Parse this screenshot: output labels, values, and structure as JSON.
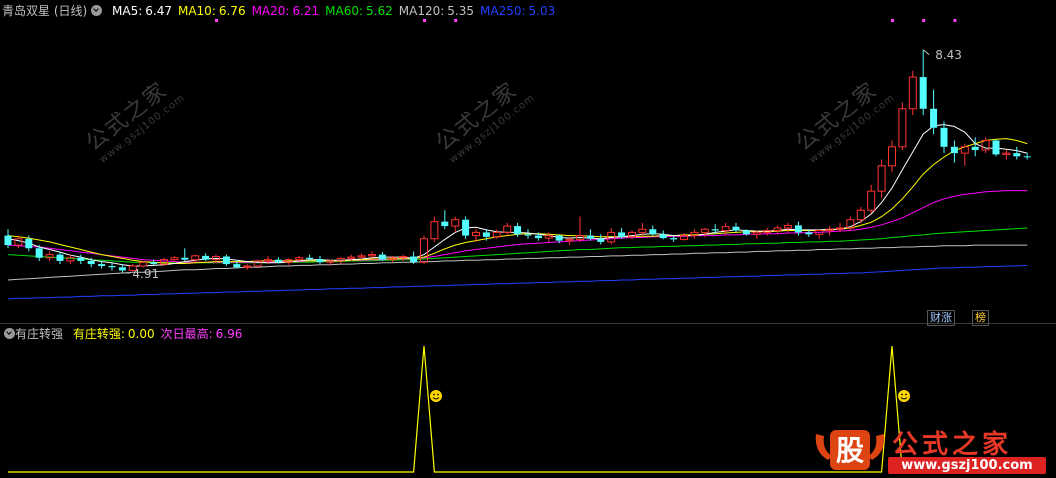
{
  "main_header": {
    "title": "青岛双星 (日线)",
    "ma": [
      {
        "label": "MA5:",
        "value": "6.47",
        "color": "#ffffff"
      },
      {
        "label": "MA10:",
        "value": "6.76",
        "color": "#ffff00"
      },
      {
        "label": "MA20:",
        "value": "6.21",
        "color": "#ff00ff"
      },
      {
        "label": "MA60:",
        "value": "5.62",
        "color": "#00e000"
      },
      {
        "label": "MA120:",
        "value": "5.35",
        "color": "#c0c0c0"
      },
      {
        "label": "MA250:",
        "value": "5.03",
        "color": "#2040ff"
      }
    ]
  },
  "sub_header": {
    "title": "有庄转强",
    "items": [
      {
        "label": "有庄转强:",
        "value": "0.00",
        "color": "#ffff00"
      },
      {
        "label": "次日最高:",
        "value": "6.96",
        "color": "#ff40ff"
      }
    ]
  },
  "annotations": {
    "high_label": "8.43",
    "low_label": "4.91",
    "tag1": "财涨",
    "tag2": "榜"
  },
  "watermark": {
    "text": "公式之家",
    "url": "www.gszj100.com"
  },
  "logo": {
    "mark": "股",
    "name": "公式之家",
    "url": "www.gszj100.com"
  },
  "colors": {
    "up": "#ff3232",
    "down": "#54ffff",
    "bg": "#000000"
  },
  "chart_data": [
    {
      "type": "candlestick",
      "title": "青岛双星 (日线)",
      "ylim": [
        4.2,
        8.9
      ],
      "candles": [
        [
          5.5,
          5.6,
          5.3,
          5.35
        ],
        [
          5.35,
          5.5,
          5.3,
          5.45
        ],
        [
          5.45,
          5.5,
          5.25,
          5.3
        ],
        [
          5.3,
          5.35,
          5.1,
          5.15
        ],
        [
          5.15,
          5.25,
          5.1,
          5.2
        ],
        [
          5.2,
          5.25,
          5.05,
          5.1
        ],
        [
          5.1,
          5.2,
          5.05,
          5.15
        ],
        [
          5.15,
          5.2,
          5.05,
          5.1
        ],
        [
          5.1,
          5.15,
          5.0,
          5.05
        ],
        [
          5.05,
          5.1,
          4.98,
          5.02
        ],
        [
          5.02,
          5.08,
          4.95,
          5.0
        ],
        [
          5.0,
          5.05,
          4.91,
          4.95
        ],
        [
          4.95,
          5.05,
          4.93,
          5.02
        ],
        [
          5.02,
          5.1,
          5.0,
          5.08
        ],
        [
          5.08,
          5.12,
          5.03,
          5.05
        ],
        [
          5.05,
          5.15,
          5.02,
          5.12
        ],
        [
          5.12,
          5.18,
          5.08,
          5.15
        ],
        [
          5.15,
          5.3,
          5.1,
          5.12
        ],
        [
          5.12,
          5.2,
          5.08,
          5.18
        ],
        [
          5.18,
          5.22,
          5.1,
          5.12
        ],
        [
          5.12,
          5.2,
          5.08,
          5.17
        ],
        [
          5.17,
          5.2,
          5.02,
          5.05
        ],
        [
          5.05,
          5.1,
          4.98,
          5.0
        ],
        [
          5.0,
          5.05,
          4.96,
          5.02
        ],
        [
          5.02,
          5.12,
          5.0,
          5.1
        ],
        [
          5.1,
          5.18,
          5.05,
          5.12
        ],
        [
          5.12,
          5.16,
          5.06,
          5.08
        ],
        [
          5.08,
          5.14,
          5.04,
          5.12
        ],
        [
          5.12,
          5.18,
          5.1,
          5.15
        ],
        [
          5.15,
          5.2,
          5.1,
          5.13
        ],
        [
          5.13,
          5.18,
          5.05,
          5.08
        ],
        [
          5.08,
          5.12,
          5.03,
          5.1
        ],
        [
          5.1,
          5.16,
          5.06,
          5.14
        ],
        [
          5.14,
          5.2,
          5.1,
          5.16
        ],
        [
          5.16,
          5.22,
          5.12,
          5.18
        ],
        [
          5.18,
          5.25,
          5.14,
          5.2
        ],
        [
          5.2,
          5.24,
          5.1,
          5.12
        ],
        [
          5.12,
          5.18,
          5.08,
          5.15
        ],
        [
          5.15,
          5.2,
          5.1,
          5.17
        ],
        [
          5.17,
          5.25,
          5.05,
          5.08
        ],
        [
          5.08,
          5.5,
          5.05,
          5.45
        ],
        [
          5.45,
          5.8,
          5.4,
          5.72
        ],
        [
          5.72,
          5.9,
          5.6,
          5.65
        ],
        [
          5.65,
          5.8,
          5.55,
          5.75
        ],
        [
          5.75,
          5.8,
          5.45,
          5.5
        ],
        [
          5.5,
          5.6,
          5.4,
          5.55
        ],
        [
          5.55,
          5.6,
          5.42,
          5.48
        ],
        [
          5.48,
          5.6,
          5.45,
          5.55
        ],
        [
          5.55,
          5.7,
          5.5,
          5.65
        ],
        [
          5.65,
          5.7,
          5.48,
          5.52
        ],
        [
          5.52,
          5.6,
          5.45,
          5.5
        ],
        [
          5.5,
          5.55,
          5.42,
          5.46
        ],
        [
          5.46,
          5.55,
          5.4,
          5.5
        ],
        [
          5.5,
          5.52,
          5.38,
          5.42
        ],
        [
          5.42,
          5.48,
          5.35,
          5.44
        ],
        [
          5.44,
          5.8,
          5.4,
          5.5
        ],
        [
          5.5,
          5.6,
          5.42,
          5.45
        ],
        [
          5.45,
          5.52,
          5.36,
          5.4
        ],
        [
          5.4,
          5.62,
          5.36,
          5.55
        ],
        [
          5.55,
          5.62,
          5.45,
          5.48
        ],
        [
          5.48,
          5.58,
          5.44,
          5.55
        ],
        [
          5.55,
          5.7,
          5.5,
          5.6
        ],
        [
          5.6,
          5.66,
          5.5,
          5.52
        ],
        [
          5.52,
          5.58,
          5.44,
          5.46
        ],
        [
          5.46,
          5.5,
          5.4,
          5.44
        ],
        [
          5.44,
          5.54,
          5.42,
          5.5
        ],
        [
          5.5,
          5.6,
          5.45,
          5.55
        ],
        [
          5.55,
          5.62,
          5.48,
          5.6
        ],
        [
          5.6,
          5.68,
          5.52,
          5.58
        ],
        [
          5.58,
          5.7,
          5.52,
          5.64
        ],
        [
          5.64,
          5.7,
          5.55,
          5.58
        ],
        [
          5.58,
          5.6,
          5.5,
          5.52
        ],
        [
          5.52,
          5.58,
          5.45,
          5.55
        ],
        [
          5.55,
          5.62,
          5.5,
          5.58
        ],
        [
          5.58,
          5.66,
          5.52,
          5.62
        ],
        [
          5.62,
          5.7,
          5.55,
          5.66
        ],
        [
          5.66,
          5.72,
          5.5,
          5.55
        ],
        [
          5.55,
          5.6,
          5.48,
          5.52
        ],
        [
          5.52,
          5.6,
          5.45,
          5.58
        ],
        [
          5.58,
          5.65,
          5.5,
          5.6
        ],
        [
          5.6,
          5.7,
          5.55,
          5.62
        ],
        [
          5.62,
          5.8,
          5.58,
          5.75
        ],
        [
          5.75,
          5.95,
          5.7,
          5.9
        ],
        [
          5.9,
          6.3,
          5.85,
          6.2
        ],
        [
          6.2,
          6.7,
          6.1,
          6.6
        ],
        [
          6.6,
          7.0,
          6.5,
          6.9
        ],
        [
          6.9,
          7.6,
          6.85,
          7.5
        ],
        [
          7.5,
          8.1,
          7.4,
          8.0
        ],
        [
          8.0,
          8.43,
          7.4,
          7.5
        ],
        [
          7.5,
          7.8,
          7.1,
          7.2
        ],
        [
          7.2,
          7.3,
          6.8,
          6.9
        ],
        [
          6.9,
          7.0,
          6.65,
          6.8
        ],
        [
          6.8,
          6.95,
          6.6,
          6.9
        ],
        [
          6.9,
          7.05,
          6.75,
          6.85
        ],
        [
          6.85,
          7.05,
          6.8,
          7.0
        ],
        [
          7.0,
          7.02,
          6.75,
          6.78
        ],
        [
          6.78,
          6.85,
          6.7,
          6.8
        ],
        [
          6.8,
          6.9,
          6.7,
          6.75
        ],
        [
          6.75,
          6.8,
          6.7,
          6.74
        ]
      ],
      "ma5": [
        5.45,
        5.42,
        5.38,
        5.32,
        5.28,
        5.24,
        5.19,
        5.16,
        5.12,
        5.09,
        5.07,
        5.04,
        5.02,
        5.02,
        5.03,
        5.04,
        5.06,
        5.09,
        5.11,
        5.13,
        5.14,
        5.13,
        5.11,
        5.09,
        5.08,
        5.07,
        5.07,
        5.08,
        5.1,
        5.12,
        5.12,
        5.11,
        5.11,
        5.12,
        5.13,
        5.15,
        5.16,
        5.16,
        5.16,
        5.14,
        5.2,
        5.32,
        5.44,
        5.55,
        5.62,
        5.63,
        5.59,
        5.56,
        5.55,
        5.55,
        5.54,
        5.52,
        5.5,
        5.47,
        5.46,
        5.47,
        5.46,
        5.45,
        5.47,
        5.48,
        5.5,
        5.52,
        5.53,
        5.52,
        5.5,
        5.5,
        5.5,
        5.52,
        5.55,
        5.57,
        5.59,
        5.58,
        5.57,
        5.57,
        5.58,
        5.6,
        5.59,
        5.59,
        5.59,
        5.6,
        5.6,
        5.64,
        5.72,
        5.84,
        6.02,
        6.25,
        6.54,
        6.82,
        7.1,
        7.23,
        7.25,
        7.22,
        7.13,
        6.95,
        6.88,
        6.88,
        6.86,
        6.84,
        6.8
      ],
      "ma10": [
        5.5,
        5.48,
        5.46,
        5.43,
        5.4,
        5.36,
        5.32,
        5.28,
        5.24,
        5.2,
        5.17,
        5.14,
        5.11,
        5.09,
        5.08,
        5.07,
        5.06,
        5.06,
        5.07,
        5.08,
        5.09,
        5.09,
        5.09,
        5.09,
        5.1,
        5.1,
        5.1,
        5.1,
        5.1,
        5.1,
        5.1,
        5.1,
        5.1,
        5.11,
        5.12,
        5.13,
        5.13,
        5.13,
        5.14,
        5.14,
        5.16,
        5.22,
        5.29,
        5.35,
        5.39,
        5.42,
        5.45,
        5.48,
        5.5,
        5.52,
        5.53,
        5.53,
        5.52,
        5.51,
        5.5,
        5.5,
        5.49,
        5.48,
        5.48,
        5.48,
        5.48,
        5.49,
        5.49,
        5.5,
        5.5,
        5.51,
        5.51,
        5.52,
        5.53,
        5.54,
        5.55,
        5.56,
        5.56,
        5.56,
        5.57,
        5.58,
        5.58,
        5.58,
        5.58,
        5.59,
        5.6,
        5.62,
        5.66,
        5.71,
        5.8,
        5.92,
        6.08,
        6.27,
        6.47,
        6.62,
        6.74,
        6.84,
        6.9,
        6.95,
        7.0,
        7.02,
        7.03,
        7.0,
        6.95
      ],
      "ma20": [
        5.35,
        5.34,
        5.33,
        5.32,
        5.3,
        5.28,
        5.26,
        5.24,
        5.22,
        5.2,
        5.18,
        5.16,
        5.14,
        5.12,
        5.11,
        5.1,
        5.09,
        5.08,
        5.08,
        5.08,
        5.08,
        5.08,
        5.08,
        5.08,
        5.08,
        5.08,
        5.09,
        5.09,
        5.09,
        5.1,
        5.1,
        5.1,
        5.1,
        5.11,
        5.11,
        5.12,
        5.12,
        5.13,
        5.13,
        5.14,
        5.15,
        5.17,
        5.2,
        5.23,
        5.26,
        5.28,
        5.3,
        5.32,
        5.34,
        5.36,
        5.37,
        5.38,
        5.39,
        5.4,
        5.41,
        5.42,
        5.43,
        5.44,
        5.45,
        5.46,
        5.47,
        5.47,
        5.48,
        5.48,
        5.49,
        5.49,
        5.5,
        5.5,
        5.5,
        5.51,
        5.51,
        5.52,
        5.52,
        5.53,
        5.53,
        5.54,
        5.54,
        5.55,
        5.55,
        5.56,
        5.57,
        5.58,
        5.6,
        5.63,
        5.67,
        5.72,
        5.78,
        5.86,
        5.94,
        6.02,
        6.08,
        6.12,
        6.15,
        6.17,
        6.19,
        6.2,
        6.21,
        6.21,
        6.21
      ],
      "ma60": [
        5.2,
        5.19,
        5.18,
        5.17,
        5.16,
        5.15,
        5.14,
        5.13,
        5.12,
        5.11,
        5.1,
        5.09,
        5.08,
        5.08,
        5.07,
        5.07,
        5.07,
        5.07,
        5.07,
        5.07,
        5.07,
        5.07,
        5.07,
        5.07,
        5.07,
        5.07,
        5.08,
        5.08,
        5.08,
        5.08,
        5.09,
        5.09,
        5.09,
        5.1,
        5.1,
        5.1,
        5.11,
        5.11,
        5.12,
        5.12,
        5.13,
        5.14,
        5.15,
        5.16,
        5.17,
        5.18,
        5.19,
        5.2,
        5.21,
        5.22,
        5.23,
        5.24,
        5.25,
        5.26,
        5.27,
        5.28,
        5.28,
        5.29,
        5.3,
        5.31,
        5.31,
        5.32,
        5.32,
        5.33,
        5.33,
        5.34,
        5.34,
        5.35,
        5.35,
        5.36,
        5.36,
        5.37,
        5.37,
        5.38,
        5.38,
        5.39,
        5.39,
        5.4,
        5.4,
        5.41,
        5.41,
        5.42,
        5.43,
        5.44,
        5.45,
        5.47,
        5.48,
        5.5,
        5.51,
        5.53,
        5.54,
        5.55,
        5.56,
        5.57,
        5.58,
        5.59,
        5.6,
        5.61,
        5.62
      ],
      "ma120": [
        4.8,
        4.81,
        4.82,
        4.83,
        4.84,
        4.85,
        4.86,
        4.87,
        4.88,
        4.89,
        4.9,
        4.91,
        4.92,
        4.92,
        4.93,
        4.94,
        4.95,
        4.96,
        4.96,
        4.97,
        4.98,
        4.98,
        4.99,
        5.0,
        5.0,
        5.01,
        5.02,
        5.02,
        5.03,
        5.03,
        5.04,
        5.04,
        5.05,
        5.05,
        5.06,
        5.06,
        5.07,
        5.07,
        5.08,
        5.08,
        5.09,
        5.09,
        5.1,
        5.1,
        5.11,
        5.11,
        5.12,
        5.12,
        5.13,
        5.13,
        5.14,
        5.14,
        5.15,
        5.15,
        5.16,
        5.16,
        5.17,
        5.17,
        5.18,
        5.18,
        5.19,
        5.19,
        5.2,
        5.2,
        5.21,
        5.21,
        5.22,
        5.22,
        5.23,
        5.23,
        5.24,
        5.24,
        5.25,
        5.25,
        5.26,
        5.26,
        5.27,
        5.27,
        5.28,
        5.28,
        5.29,
        5.29,
        5.3,
        5.3,
        5.31,
        5.31,
        5.32,
        5.32,
        5.33,
        5.33,
        5.34,
        5.34,
        5.34,
        5.35,
        5.35,
        5.35,
        5.35,
        5.35,
        5.35
      ],
      "ma250": [
        4.5,
        4.51,
        4.51,
        4.52,
        4.52,
        4.53,
        4.53,
        4.54,
        4.54,
        4.55,
        4.55,
        4.56,
        4.56,
        4.57,
        4.57,
        4.58,
        4.58,
        4.59,
        4.59,
        4.6,
        4.6,
        4.61,
        4.61,
        4.62,
        4.62,
        4.63,
        4.63,
        4.64,
        4.64,
        4.65,
        4.65,
        4.66,
        4.66,
        4.67,
        4.67,
        4.68,
        4.68,
        4.69,
        4.69,
        4.7,
        4.7,
        4.71,
        4.71,
        4.72,
        4.72,
        4.73,
        4.73,
        4.74,
        4.74,
        4.75,
        4.75,
        4.76,
        4.76,
        4.77,
        4.77,
        4.78,
        4.78,
        4.79,
        4.79,
        4.8,
        4.8,
        4.81,
        4.81,
        4.82,
        4.82,
        4.83,
        4.83,
        4.84,
        4.84,
        4.85,
        4.85,
        4.86,
        4.86,
        4.87,
        4.87,
        4.88,
        4.88,
        4.89,
        4.89,
        4.9,
        4.9,
        4.91,
        4.91,
        4.92,
        4.93,
        4.94,
        4.95,
        4.96,
        4.97,
        4.98,
        4.99,
        4.99,
        5.0,
        5.0,
        5.01,
        5.01,
        5.02,
        5.02,
        5.03
      ]
    },
    {
      "type": "line",
      "title": "有庄转强",
      "ylim": [
        0,
        1
      ],
      "signal": [
        0,
        0,
        0,
        0,
        0,
        0,
        0,
        0,
        0,
        0,
        0,
        0,
        0,
        0,
        0,
        0,
        0,
        0,
        0,
        0,
        0,
        0,
        0,
        0,
        0,
        0,
        0,
        0,
        0,
        0,
        0,
        0,
        0,
        0,
        0,
        0,
        0,
        0,
        0,
        0,
        1,
        0,
        0,
        0,
        0,
        0,
        0,
        0,
        0,
        0,
        0,
        0,
        0,
        0,
        0,
        0,
        0,
        0,
        0,
        0,
        0,
        0,
        0,
        0,
        0,
        0,
        0,
        0,
        0,
        0,
        0,
        0,
        0,
        0,
        0,
        0,
        0,
        0,
        0,
        0,
        0,
        0,
        0,
        0,
        0,
        1,
        0,
        0,
        0,
        0,
        0,
        0,
        0,
        0,
        0,
        0,
        0,
        0,
        0
      ],
      "marks": [
        40,
        85
      ]
    }
  ]
}
